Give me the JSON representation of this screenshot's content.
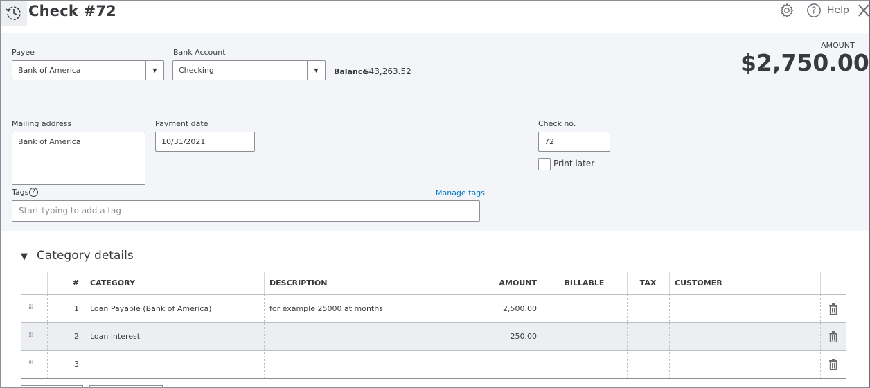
{
  "header": {
    "title": "Check #72",
    "help_label": "Help"
  },
  "form": {
    "payee_label": "Payee",
    "payee_value": "Bank of America",
    "bank_account_label": "Bank Account",
    "bank_account_value": "Checking",
    "balance_label": "Balance",
    "balance_value": "$43,263.52",
    "amount_label": "AMOUNT",
    "amount_value": "$2,750.00",
    "mailing_address_label": "Mailing address",
    "mailing_address_value": "Bank of America",
    "payment_date_label": "Payment date",
    "payment_date_value": "10/31/2021",
    "check_no_label": "Check no.",
    "check_no_value": "72",
    "print_later_label": "Print later",
    "print_later_checked": false,
    "tags_label": "Tags",
    "tags_help_glyph": "?",
    "manage_tags_label": "Manage tags",
    "tags_placeholder": "Start typing to add a tag"
  },
  "category_details": {
    "title": "Category details",
    "columns": [
      "#",
      "CATEGORY",
      "DESCRIPTION",
      "AMOUNT",
      "BILLABLE",
      "TAX",
      "CUSTOMER"
    ],
    "rows": [
      {
        "num": "1",
        "category": "Loan Payable (Bank of America)",
        "description": "for example 25000 at months",
        "amount": "2,500.00"
      },
      {
        "num": "2",
        "category": "Loan interest",
        "description": "",
        "amount": "250.00"
      },
      {
        "num": "3",
        "category": "",
        "description": "",
        "amount": ""
      }
    ]
  },
  "colors": {
    "link": "#0077c5",
    "form_bg": "#f4f5f8",
    "text": "#393a3d"
  }
}
